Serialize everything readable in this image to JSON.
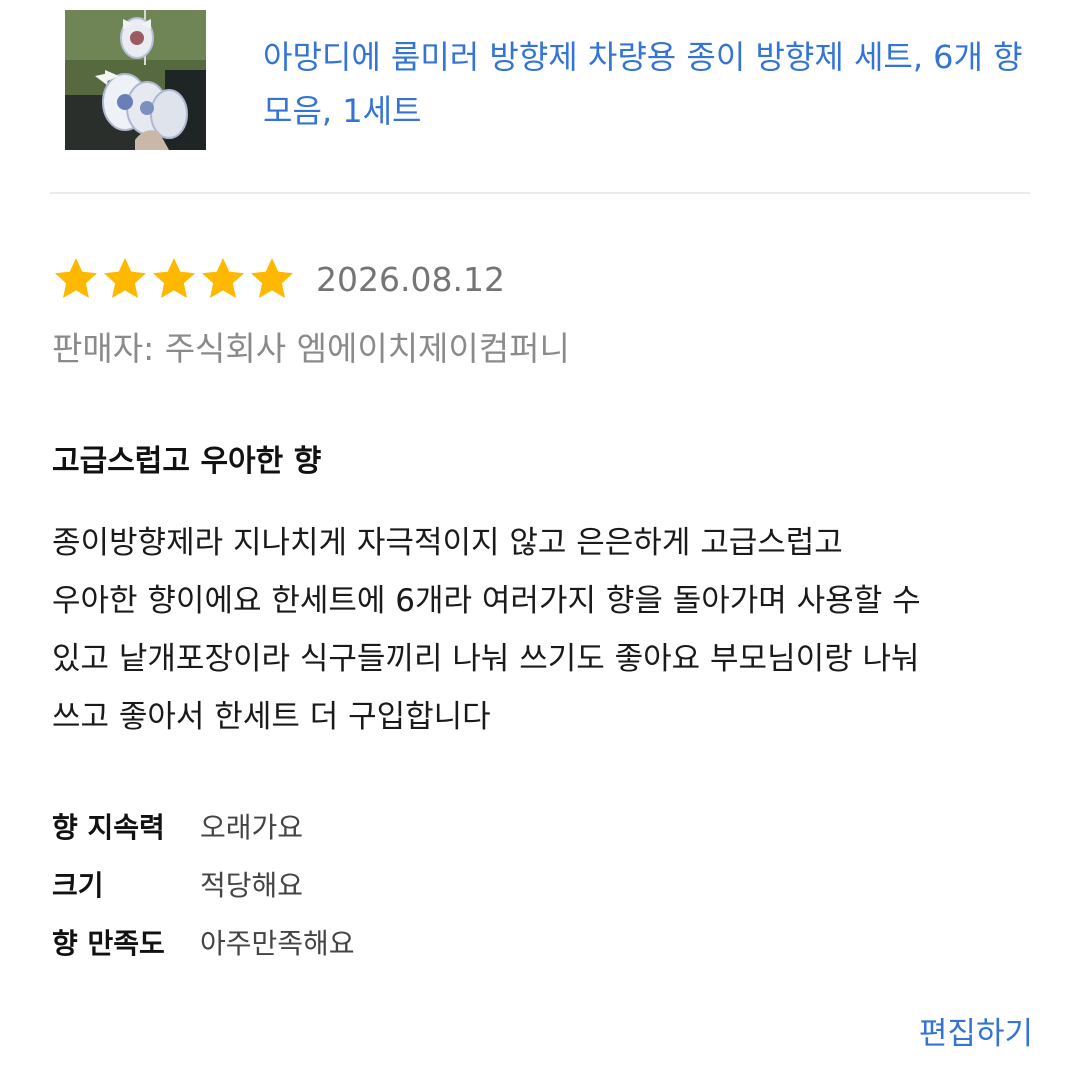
{
  "product": {
    "title": "아망디에 룸미러 방향제 차량용 종이 방향제 세트, 6개 향 모음, 1세트",
    "thumbnail_icon": "product-photo"
  },
  "review": {
    "rating": 5,
    "rating_max": 5,
    "date": "2026.08.12",
    "seller": "판매자: 주식회사 엠에이치제이컴퍼니",
    "headline": "고급스럽고 우아한 향",
    "body": "종이방향제라 지나치게 자극적이지 않고 은은하게 고급스럽고\n우아한 향이에요 한세트에 6개라 여러가지 향을 돌아가며 사용할 수\n있고 낱개포장이라 식구들끼리 나눠 쓰기도 좋아요 부모님이랑 나눠\n쓰고 좋아서 한세트 더 구입합니다",
    "attributes": [
      {
        "label": "향 지속력",
        "value": "오래가요"
      },
      {
        "label": "크기",
        "value": "적당해요"
      },
      {
        "label": "향 만족도",
        "value": "아주만족해요"
      }
    ]
  },
  "actions": {
    "edit_label": "편집하기"
  },
  "colors": {
    "link": "#3474d6",
    "star": "#ffb800",
    "divider": "#ebebeb"
  }
}
